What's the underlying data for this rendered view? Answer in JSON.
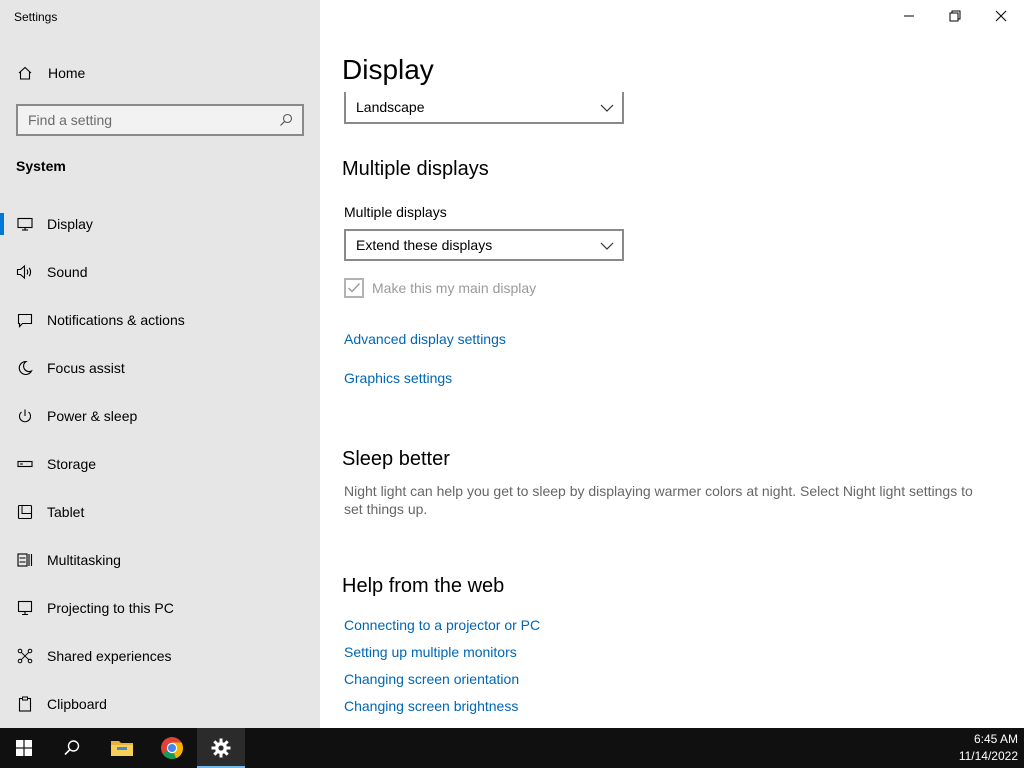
{
  "window": {
    "title": "Settings",
    "controls": {
      "minimize": "minimize-icon",
      "restore": "restore-icon",
      "close": "close-icon"
    }
  },
  "sidebar": {
    "home_label": "Home",
    "search_placeholder": "Find a setting",
    "section": "System",
    "items": [
      {
        "label": "Display",
        "icon": "monitor-icon",
        "active": true
      },
      {
        "label": "Sound",
        "icon": "speaker-icon"
      },
      {
        "label": "Notifications & actions",
        "icon": "notification-icon"
      },
      {
        "label": "Focus assist",
        "icon": "moon-icon"
      },
      {
        "label": "Power & sleep",
        "icon": "power-icon"
      },
      {
        "label": "Storage",
        "icon": "storage-icon"
      },
      {
        "label": "Tablet",
        "icon": "tablet-icon"
      },
      {
        "label": "Multitasking",
        "icon": "multitasking-icon"
      },
      {
        "label": "Projecting to this PC",
        "icon": "projecting-icon"
      },
      {
        "label": "Shared experiences",
        "icon": "shared-experiences-icon"
      },
      {
        "label": "Clipboard",
        "icon": "clipboard-icon"
      }
    ]
  },
  "main": {
    "title": "Display",
    "orientation_value": "Landscape",
    "multiple_displays": {
      "heading": "Multiple displays",
      "label": "Multiple displays",
      "value": "Extend these displays",
      "checkbox_label": "Make this my main display",
      "checkbox_checked": true,
      "checkbox_disabled": true
    },
    "links": {
      "advanced": "Advanced display settings",
      "graphics": "Graphics settings"
    },
    "sleep": {
      "heading": "Sleep better",
      "description": "Night light can help you get to sleep by displaying warmer colors at night. Select Night light settings to set things up."
    },
    "help": {
      "heading": "Help from the web",
      "links": [
        "Connecting to a projector or PC",
        "Setting up multiple monitors",
        "Changing screen orientation",
        "Changing screen brightness"
      ]
    }
  },
  "taskbar": {
    "items": [
      "start-icon",
      "search-icon",
      "file-explorer-icon",
      "chrome-icon",
      "settings-icon"
    ],
    "active_item": "settings-icon",
    "time": "6:45 AM",
    "date": "11/14/2022"
  },
  "colors": {
    "accent": "#0078d7",
    "link": "#0066b4",
    "sidebar_bg": "#e6e6e6",
    "taskbar_bg": "#101010"
  }
}
